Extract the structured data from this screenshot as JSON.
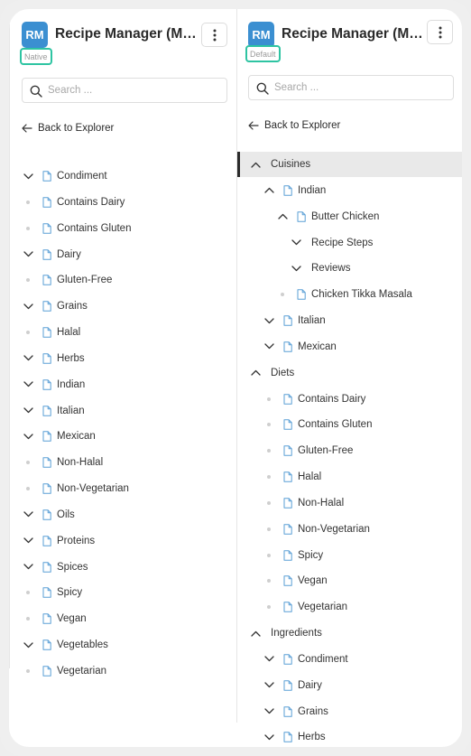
{
  "left": {
    "logo": "RM",
    "title": "Recipe Manager (Metadata)",
    "badge": "Native",
    "search_placeholder": "Search ...",
    "back_label": "Back to Explorer",
    "items": [
      {
        "label": "Condiment",
        "toggle": "expanded"
      },
      {
        "label": "Contains Dairy",
        "toggle": "leaf"
      },
      {
        "label": "Contains Gluten",
        "toggle": "leaf"
      },
      {
        "label": "Dairy",
        "toggle": "expanded"
      },
      {
        "label": "Gluten-Free",
        "toggle": "leaf"
      },
      {
        "label": "Grains",
        "toggle": "expanded"
      },
      {
        "label": "Halal",
        "toggle": "leaf"
      },
      {
        "label": "Herbs",
        "toggle": "expanded"
      },
      {
        "label": "Indian",
        "toggle": "expanded"
      },
      {
        "label": "Italian",
        "toggle": "expanded"
      },
      {
        "label": "Mexican",
        "toggle": "expanded"
      },
      {
        "label": "Non-Halal",
        "toggle": "leaf"
      },
      {
        "label": "Non-Vegetarian",
        "toggle": "leaf"
      },
      {
        "label": "Oils",
        "toggle": "expanded"
      },
      {
        "label": "Proteins",
        "toggle": "expanded"
      },
      {
        "label": "Spices",
        "toggle": "expanded"
      },
      {
        "label": "Spicy",
        "toggle": "leaf"
      },
      {
        "label": "Vegan",
        "toggle": "leaf"
      },
      {
        "label": "Vegetables",
        "toggle": "expanded"
      },
      {
        "label": "Vegetarian",
        "toggle": "leaf"
      }
    ]
  },
  "right": {
    "logo": "RM",
    "title": "Recipe Manager (Metadata)",
    "badge": "Default",
    "search_placeholder": "Search ...",
    "back_label": "Back to Explorer",
    "items": [
      {
        "label": "Cuisines",
        "level": 0,
        "toggle": "up",
        "type": "category",
        "selected": true
      },
      {
        "label": "Indian",
        "level": 1,
        "toggle": "up",
        "type": "page"
      },
      {
        "label": "Butter Chicken",
        "level": 2,
        "toggle": "up",
        "type": "page"
      },
      {
        "label": "Recipe Steps",
        "level": 3,
        "toggle": "down",
        "type": "category"
      },
      {
        "label": "Reviews",
        "level": 3,
        "toggle": "down",
        "type": "category"
      },
      {
        "label": "Chicken Tikka Masala",
        "level": 2,
        "toggle": "leaf",
        "type": "page"
      },
      {
        "label": "Italian",
        "level": 1,
        "toggle": "down",
        "type": "page"
      },
      {
        "label": "Mexican",
        "level": 1,
        "toggle": "down",
        "type": "page"
      },
      {
        "label": "Diets",
        "level": 0,
        "toggle": "up",
        "type": "category"
      },
      {
        "label": "Contains Dairy",
        "level": 1,
        "toggle": "leaf",
        "type": "page"
      },
      {
        "label": "Contains Gluten",
        "level": 1,
        "toggle": "leaf",
        "type": "page"
      },
      {
        "label": "Gluten-Free",
        "level": 1,
        "toggle": "leaf",
        "type": "page"
      },
      {
        "label": "Halal",
        "level": 1,
        "toggle": "leaf",
        "type": "page"
      },
      {
        "label": "Non-Halal",
        "level": 1,
        "toggle": "leaf",
        "type": "page"
      },
      {
        "label": "Non-Vegetarian",
        "level": 1,
        "toggle": "leaf",
        "type": "page"
      },
      {
        "label": "Spicy",
        "level": 1,
        "toggle": "leaf",
        "type": "page"
      },
      {
        "label": "Vegan",
        "level": 1,
        "toggle": "leaf",
        "type": "page"
      },
      {
        "label": "Vegetarian",
        "level": 1,
        "toggle": "leaf",
        "type": "page"
      },
      {
        "label": "Ingredients",
        "level": 0,
        "toggle": "up",
        "type": "category"
      },
      {
        "label": "Condiment",
        "level": 1,
        "toggle": "down",
        "type": "page"
      },
      {
        "label": "Dairy",
        "level": 1,
        "toggle": "down",
        "type": "page"
      },
      {
        "label": "Grains",
        "level": 1,
        "toggle": "down",
        "type": "page"
      },
      {
        "label": "Herbs",
        "level": 1,
        "toggle": "down",
        "type": "page"
      }
    ]
  },
  "colors": {
    "logo_bg": "#3b8fd1",
    "badge_border": "#2ec4a2",
    "doc_icon": "#5a9fd6",
    "selected_bg": "#e9e9e9"
  }
}
